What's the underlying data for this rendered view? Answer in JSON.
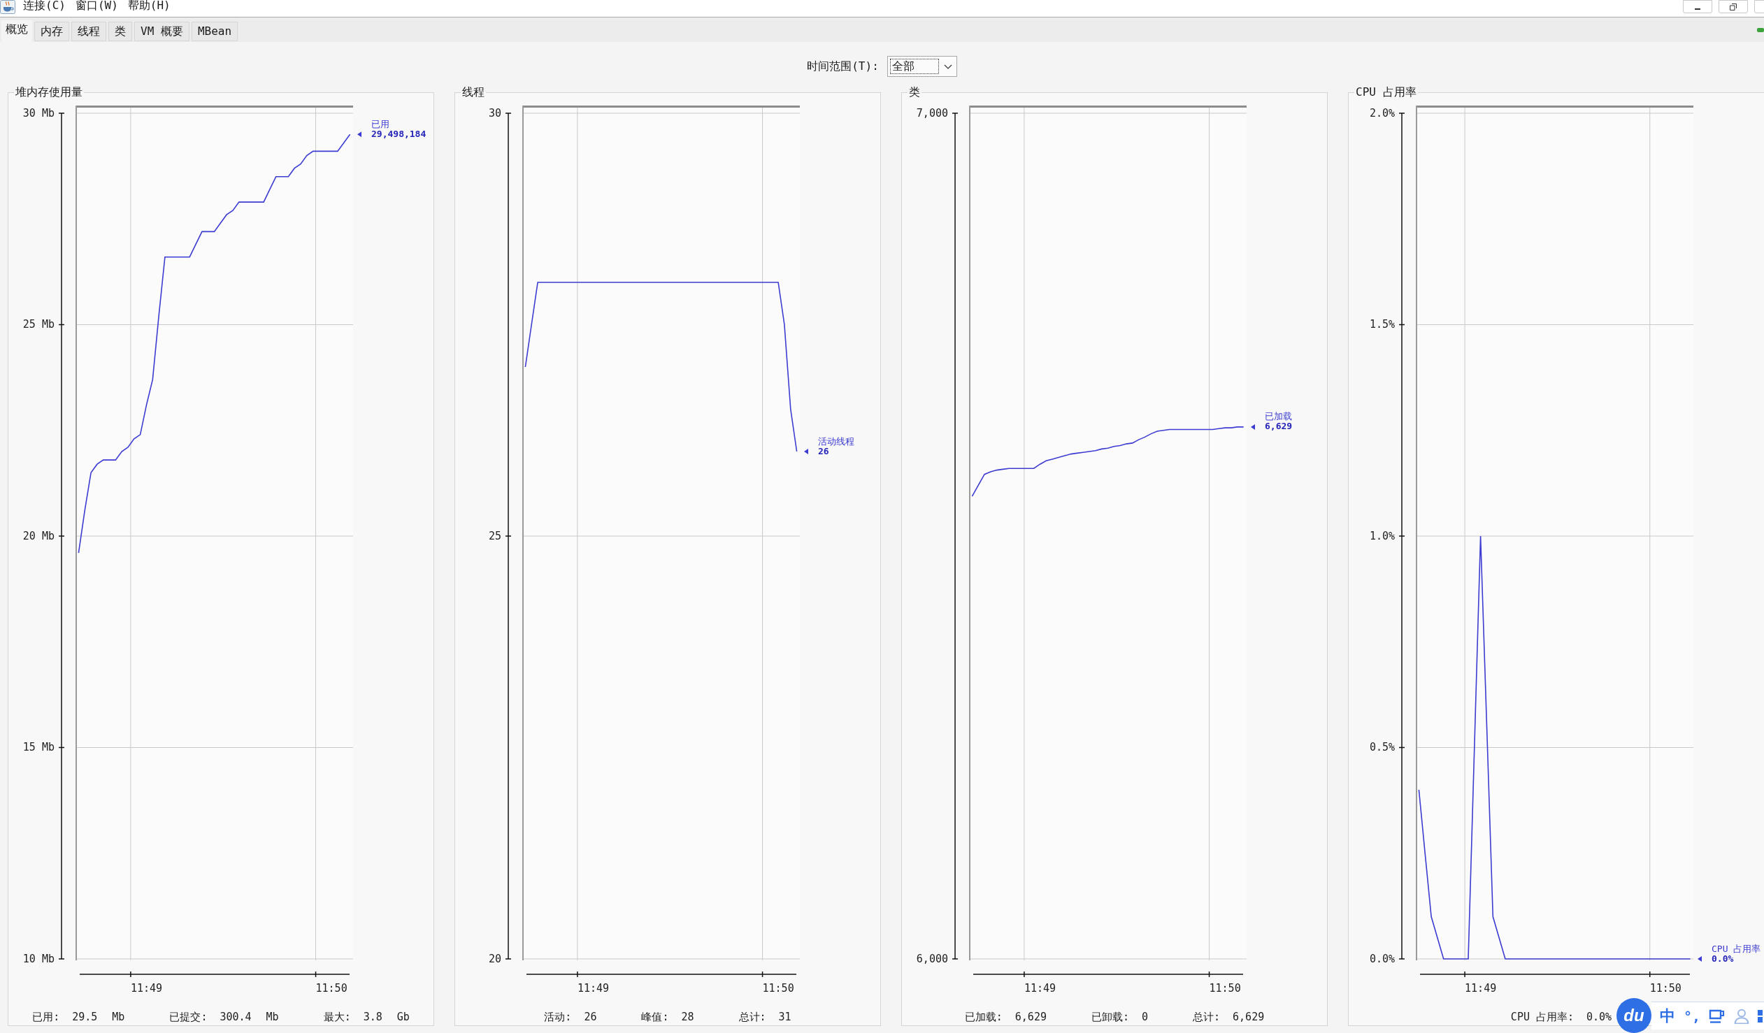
{
  "menu": [
    "连接(C)",
    "窗口(W)",
    "帮助(H)"
  ],
  "tabs": [
    {
      "label": "概览",
      "selected": true
    },
    {
      "label": "内存",
      "selected": false
    },
    {
      "label": "线程",
      "selected": false
    },
    {
      "label": "类",
      "selected": false
    },
    {
      "label": "VM 概要",
      "selected": false
    },
    {
      "label": "MBean",
      "selected": false
    }
  ],
  "time_range": {
    "label": "时间范围(T):",
    "value": "全部"
  },
  "panels": [
    {
      "title": "堆内存使用量",
      "legend_value": "29,498,184",
      "chart_data": {
        "type": "line",
        "grid": true,
        "categories": [
          null,
          null,
          null,
          null,
          null,
          null,
          null,
          null,
          null,
          null,
          null,
          "11:49",
          null,
          null,
          null,
          null,
          null,
          null,
          null,
          null,
          null,
          null,
          null,
          null,
          null,
          null,
          null,
          null,
          null,
          null,
          null,
          null,
          null,
          null,
          null,
          null,
          null,
          null,
          null,
          null,
          null,
          "11:50",
          null,
          null,
          null
        ],
        "series": [
          {
            "name": "已用",
            "color": "#3c3cd2",
            "values": [
              19.6,
              20.6,
              21.5,
              21.7,
              21.8,
              21.8,
              21.8,
              22.0,
              22.1,
              22.3,
              22.4,
              23.1,
              23.7,
              25.2,
              26.6,
              26.6,
              26.6,
              26.6,
              26.6,
              26.9,
              27.2,
              27.2,
              27.2,
              27.4,
              27.6,
              27.7,
              27.9,
              27.9,
              27.9,
              27.9,
              27.9,
              28.2,
              28.5,
              28.5,
              28.5,
              28.7,
              28.8,
              29.0,
              29.1,
              29.1,
              29.1,
              29.1,
              29.1,
              29.3,
              29.5
            ]
          }
        ],
        "ylim": [
          10,
          30
        ],
        "yticks": [
          {
            "value": 10,
            "label": "10 Mb"
          },
          {
            "value": 15,
            "label": "15 Mb"
          },
          {
            "value": 20,
            "label": "20 Mb"
          },
          {
            "value": 25,
            "label": "25 Mb"
          },
          {
            "value": 30,
            "label": "30 Mb"
          }
        ]
      },
      "stats": [
        {
          "label": "已用:",
          "value": "29.5 Mb"
        },
        {
          "label": "已提交:",
          "value": "300.4 Mb"
        },
        {
          "label": "最大:",
          "value": "3.8 Gb"
        }
      ]
    },
    {
      "title": "线程",
      "legend_value": "26",
      "chart_data": {
        "type": "line",
        "grid": true,
        "categories": [
          null,
          null,
          null,
          null,
          null,
          null,
          null,
          null,
          null,
          null,
          null,
          "11:49",
          null,
          null,
          null,
          null,
          null,
          null,
          null,
          null,
          null,
          null,
          null,
          null,
          null,
          null,
          null,
          null,
          null,
          null,
          null,
          null,
          null,
          null,
          null,
          null,
          null,
          null,
          null,
          null,
          null,
          "11:50",
          null,
          null,
          null
        ],
        "series": [
          {
            "name": "活动线程",
            "color": "#3c3cd2",
            "values": [
              27,
              27.5,
              28,
              28,
              28,
              28,
              28,
              28,
              28,
              28,
              28,
              28,
              28,
              28,
              28,
              28,
              28,
              28,
              28,
              28,
              28,
              28,
              28,
              28,
              28,
              28,
              28,
              28,
              28,
              28,
              28,
              28,
              28,
              28,
              28,
              28,
              28,
              28,
              28,
              28,
              28,
              28,
              27.5,
              26.5,
              26
            ]
          }
        ],
        "ylim": [
          20,
          30
        ],
        "yticks": [
          {
            "value": 20,
            "label": "20"
          },
          {
            "value": 25,
            "label": "25"
          },
          {
            "value": 30,
            "label": "30"
          }
        ]
      },
      "stats": [
        {
          "label": "活动:",
          "value": "26"
        },
        {
          "label": "峰值:",
          "value": "28"
        },
        {
          "label": "总计:",
          "value": "31"
        }
      ]
    },
    {
      "title": "类",
      "legend_value": "6,629",
      "chart_data": {
        "type": "line",
        "grid": true,
        "categories": [
          null,
          null,
          null,
          null,
          null,
          null,
          null,
          null,
          null,
          null,
          null,
          "11:49",
          null,
          null,
          null,
          null,
          null,
          null,
          null,
          null,
          null,
          null,
          null,
          null,
          null,
          null,
          null,
          null,
          null,
          null,
          null,
          null,
          null,
          null,
          null,
          null,
          null,
          null,
          null,
          null,
          null,
          "11:50",
          null,
          null,
          null
        ],
        "series": [
          {
            "name": "已加载",
            "color": "#3c3cd2",
            "values": [
              6547,
              6560,
              6573,
              6576,
              6578,
              6579,
              6580,
              6580,
              6580,
              6580,
              6580,
              6585,
              6589,
              6591,
              6593,
              6595,
              6597,
              6598,
              6599,
              6600,
              6601,
              6603,
              6604,
              6606,
              6607,
              6609,
              6610,
              6614,
              6617,
              6621,
              6624,
              6625,
              6626,
              6626,
              6626,
              6626,
              6626,
              6626,
              6626,
              6626,
              6627,
              6628,
              6628,
              6629,
              6629
            ]
          }
        ],
        "ylim": [
          6000,
          7000
        ],
        "yticks": [
          {
            "value": 6000,
            "label": "6,000"
          },
          {
            "value": 7000,
            "label": "7,000"
          }
        ]
      },
      "stats": [
        {
          "label": "已加载:",
          "value": "6,629"
        },
        {
          "label": "已卸载:",
          "value": "0"
        },
        {
          "label": "总计:",
          "value": "6,629"
        }
      ]
    },
    {
      "title": "CPU 占用率",
      "legend_value": "0.0%",
      "chart_data": {
        "type": "line",
        "grid": true,
        "categories": [
          null,
          null,
          null,
          null,
          null,
          null,
          null,
          null,
          null,
          null,
          "11:49",
          null,
          null,
          null,
          null,
          null,
          null,
          null,
          null,
          null,
          null,
          null,
          null,
          null,
          null,
          null,
          null,
          null,
          null,
          null,
          null,
          null,
          null,
          null,
          null,
          null,
          null,
          null,
          null,
          null,
          "11:50",
          null,
          null,
          null,
          null
        ],
        "series": [
          {
            "name": "CPU 占用率",
            "color": "#3c3cd2",
            "values": [
              0.4,
              0.25,
              0.1,
              0.05,
              0,
              0,
              0,
              0,
              0,
              0.5,
              1.0,
              0.55,
              0.1,
              0.05,
              0,
              0,
              0,
              0,
              0,
              0,
              0,
              0,
              0,
              0,
              0,
              0,
              0,
              0,
              0,
              0,
              0,
              0,
              0,
              0,
              0,
              0,
              0,
              0,
              0,
              0,
              0,
              0,
              0,
              0,
              0
            ]
          }
        ],
        "ylim": [
          0,
          2
        ],
        "yticks": [
          {
            "value": 0,
            "label": "0.0%"
          },
          {
            "value": 0.5,
            "label": "0.5%"
          },
          {
            "value": 1,
            "label": "1.0%"
          },
          {
            "value": 1.5,
            "label": "1.5%"
          },
          {
            "value": 2,
            "label": "2.0%"
          }
        ]
      },
      "stats": [
        {
          "label": "CPU 占用率:",
          "value": "0.0%"
        }
      ]
    }
  ],
  "ime_toolbar": {
    "logo": "du",
    "mode": "中",
    "punctuation": "°,"
  }
}
